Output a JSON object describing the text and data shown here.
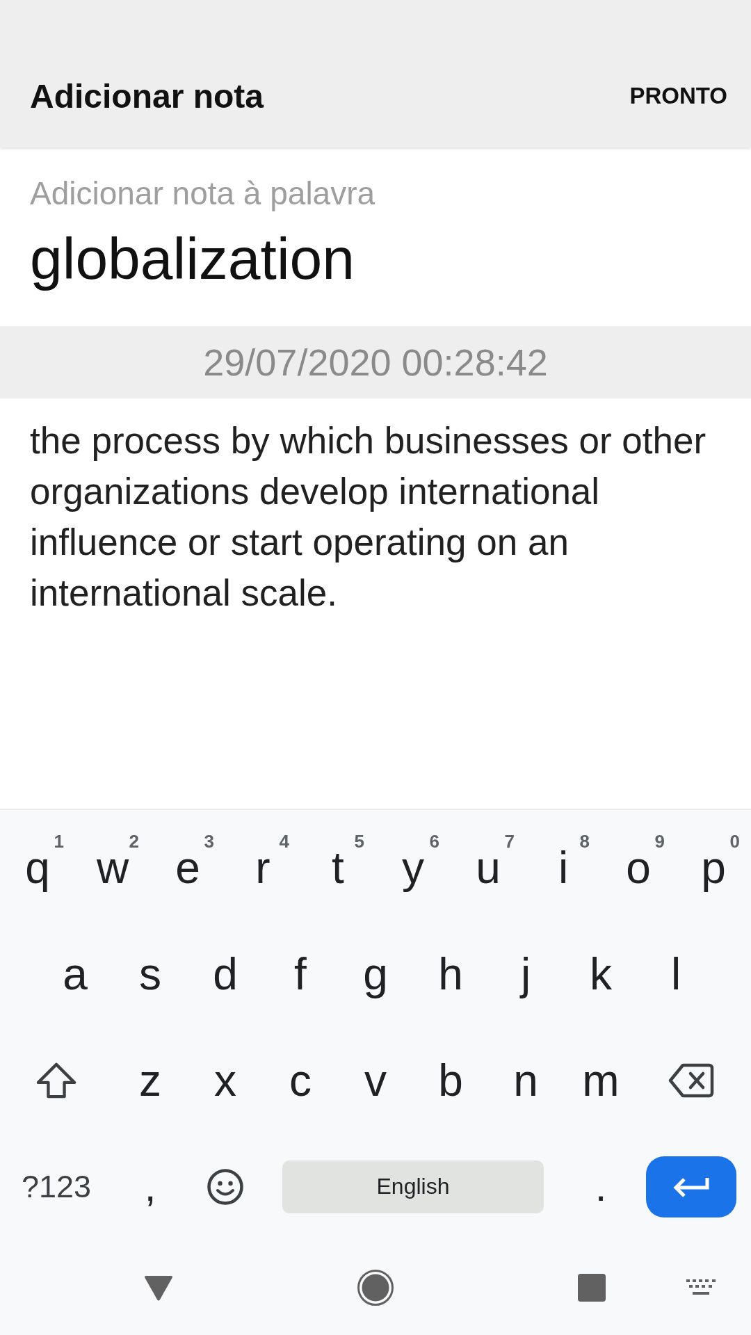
{
  "app_bar": {
    "title": "Adicionar nota",
    "action": "PRONTO"
  },
  "word": {
    "label": "Adicionar nota à palavra",
    "value": "globalization"
  },
  "timestamp": "29/07/2020 00:28:42",
  "note": {
    "value": "the process by which businesses or other organizations develop international influence or start operating on an international scale."
  },
  "keyboard": {
    "rows": [
      {
        "keys": [
          {
            "kind": "letter",
            "label": "q",
            "hint": "1"
          },
          {
            "kind": "letter",
            "label": "w",
            "hint": "2"
          },
          {
            "kind": "letter",
            "label": "e",
            "hint": "3"
          },
          {
            "kind": "letter",
            "label": "r",
            "hint": "4"
          },
          {
            "kind": "letter",
            "label": "t",
            "hint": "5"
          },
          {
            "kind": "letter",
            "label": "y",
            "hint": "6"
          },
          {
            "kind": "letter",
            "label": "u",
            "hint": "7"
          },
          {
            "kind": "letter",
            "label": "i",
            "hint": "8"
          },
          {
            "kind": "letter",
            "label": "o",
            "hint": "9"
          },
          {
            "kind": "letter",
            "label": "p",
            "hint": "0"
          }
        ]
      },
      {
        "keys": [
          {
            "kind": "letter",
            "label": "a"
          },
          {
            "kind": "letter",
            "label": "s"
          },
          {
            "kind": "letter",
            "label": "d"
          },
          {
            "kind": "letter",
            "label": "f"
          },
          {
            "kind": "letter",
            "label": "g"
          },
          {
            "kind": "letter",
            "label": "h"
          },
          {
            "kind": "letter",
            "label": "j"
          },
          {
            "kind": "letter",
            "label": "k"
          },
          {
            "kind": "letter",
            "label": "l"
          }
        ]
      },
      {
        "keys": [
          {
            "kind": "shift"
          },
          {
            "kind": "letter",
            "label": "z"
          },
          {
            "kind": "letter",
            "label": "x"
          },
          {
            "kind": "letter",
            "label": "c"
          },
          {
            "kind": "letter",
            "label": "v"
          },
          {
            "kind": "letter",
            "label": "b"
          },
          {
            "kind": "letter",
            "label": "n"
          },
          {
            "kind": "letter",
            "label": "m"
          },
          {
            "kind": "backspace"
          }
        ]
      },
      {
        "keys": [
          {
            "kind": "symbols",
            "label": "?123"
          },
          {
            "kind": "punct",
            "label": ","
          },
          {
            "kind": "emoji"
          },
          {
            "kind": "space",
            "label": "English"
          },
          {
            "kind": "punct",
            "label": "."
          },
          {
            "kind": "enter"
          }
        ]
      }
    ]
  },
  "nav_bar": [
    {
      "kind": "back"
    },
    {
      "kind": "home"
    },
    {
      "kind": "recents"
    },
    {
      "kind": "keyboard"
    }
  ]
}
